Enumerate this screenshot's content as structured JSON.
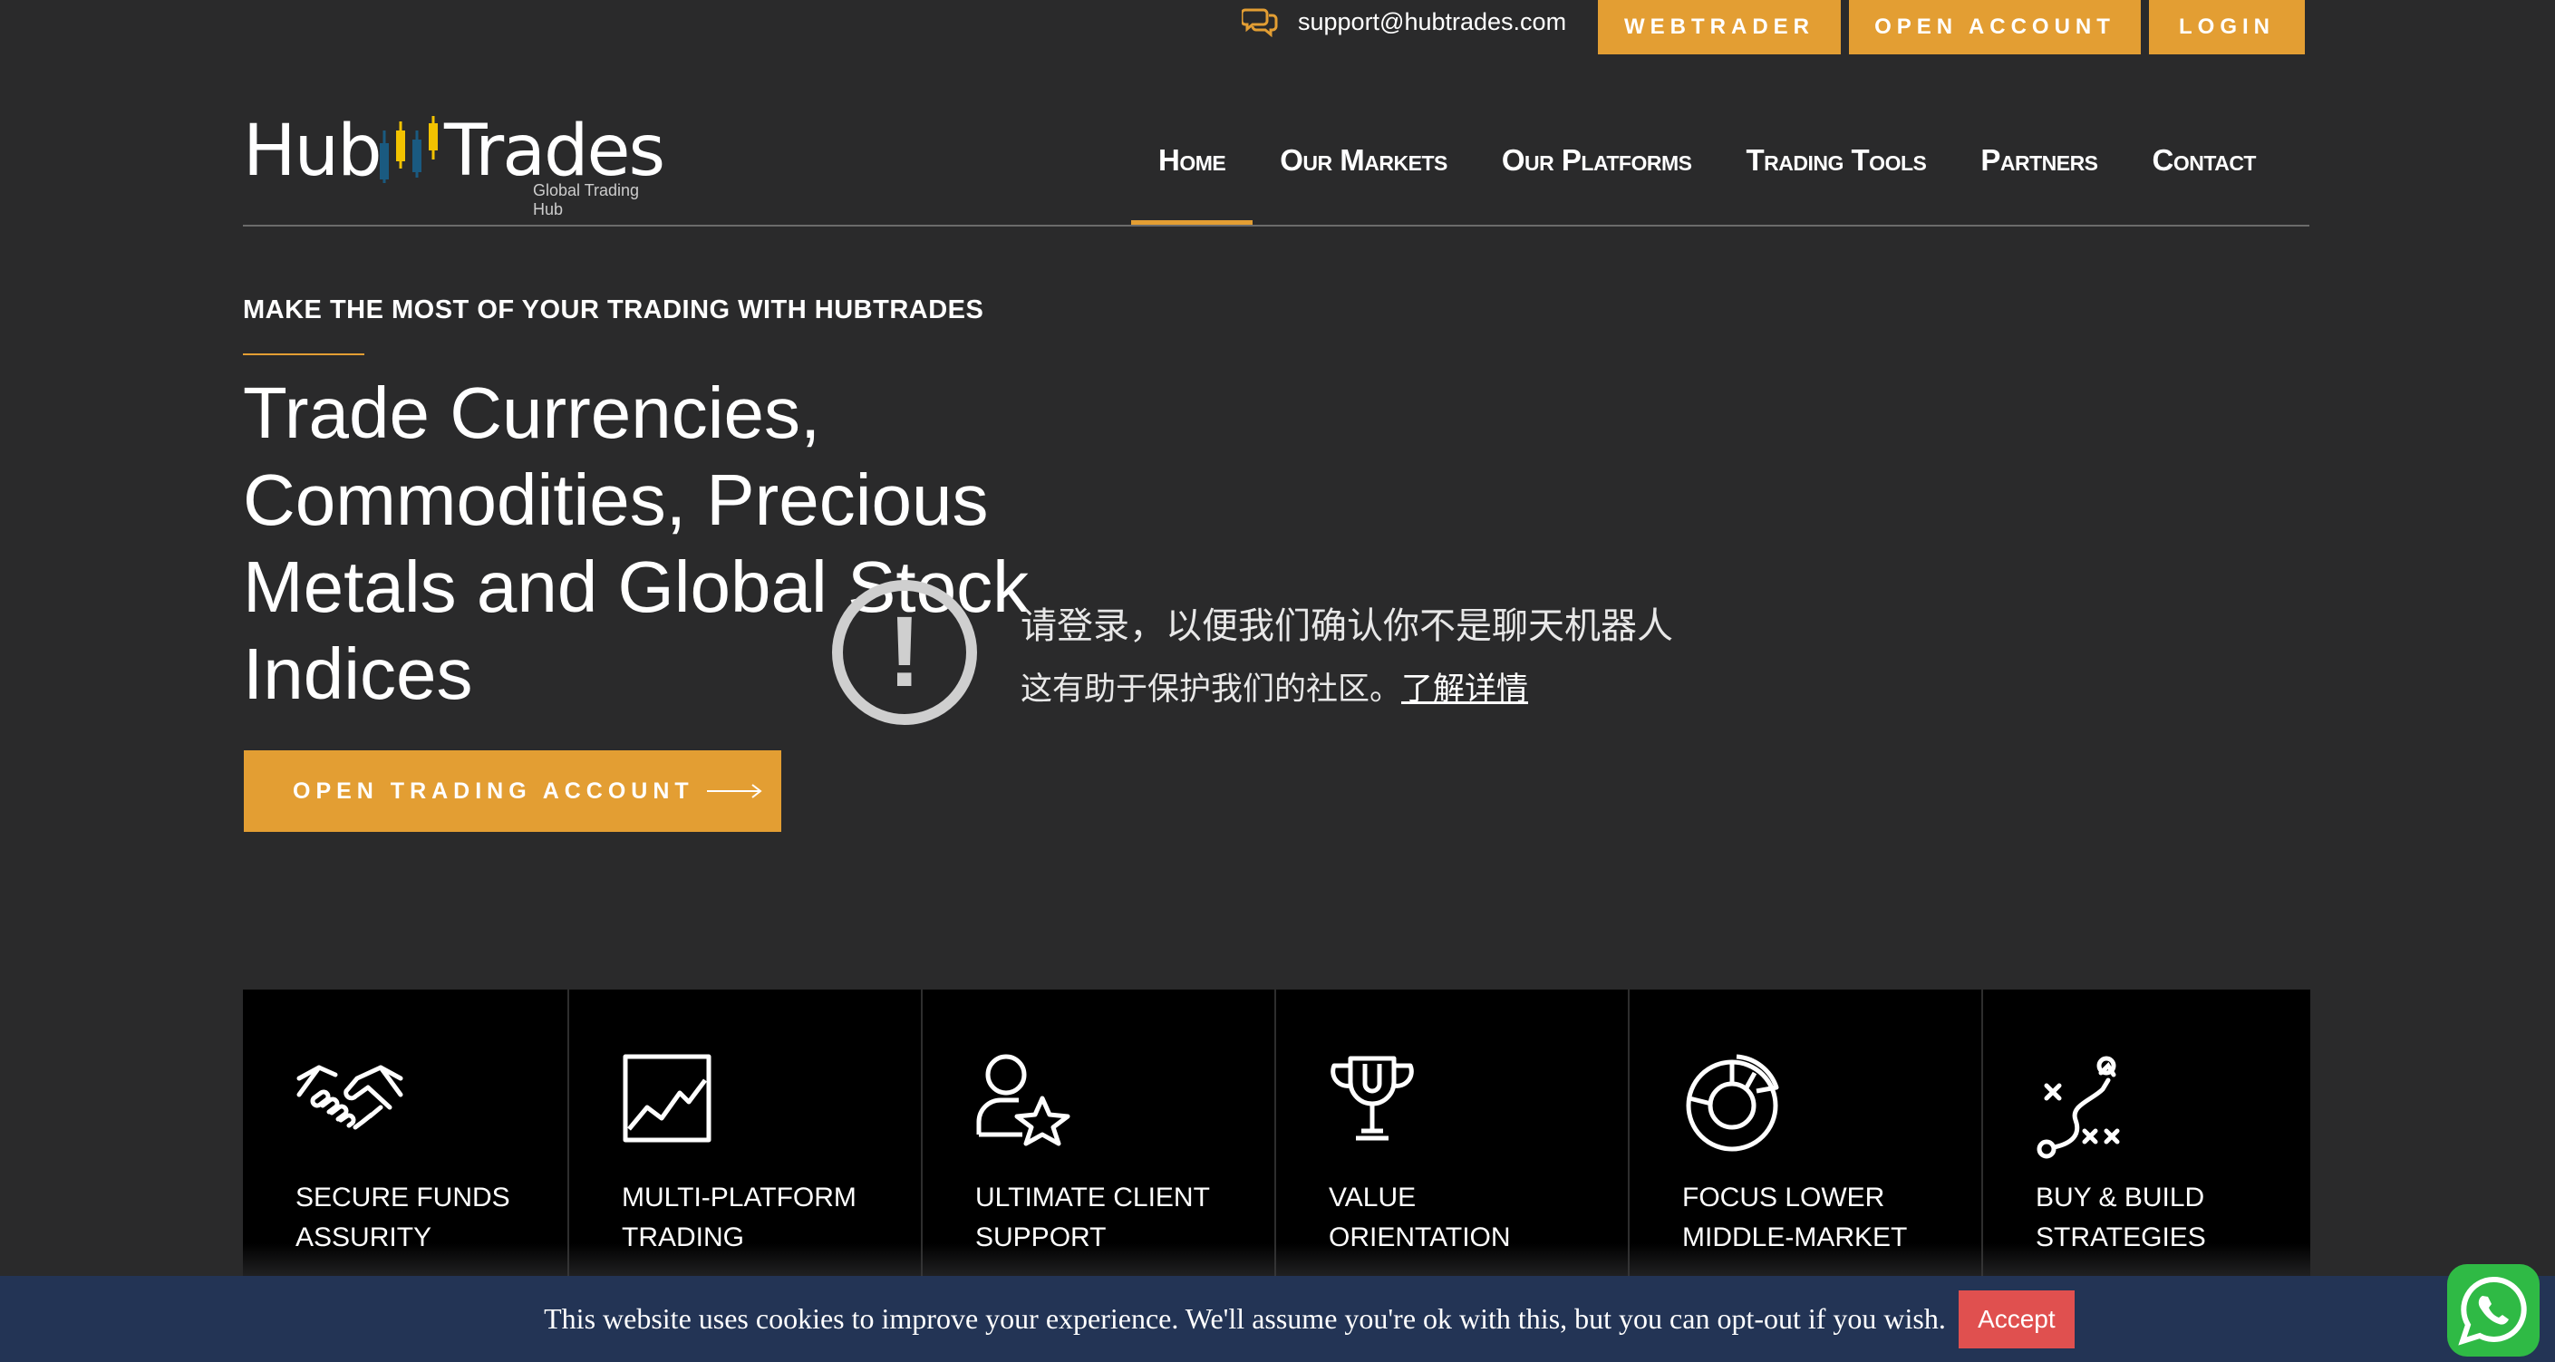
{
  "topbar": {
    "support_email": "support@hubtrades.com",
    "buttons": [
      "WEBTRADER",
      "OPEN ACCOUNT",
      "LOGIN"
    ]
  },
  "logo": {
    "part1": "Hub",
    "part2": "Trades",
    "tagline": "Global Trading Hub"
  },
  "nav": {
    "items": [
      "Home",
      "Our Markets",
      "Our Platforms",
      "Trading Tools",
      "Partners",
      "Contact"
    ],
    "active": "Home"
  },
  "hero": {
    "kicker": "MAKE THE MOST OF YOUR TRADING WITH HUBTRADES",
    "headline": "Trade Currencies, Commodities, Precious Metals and Global Stock Indices",
    "cta": "OPEN TRADING ACCOUNT"
  },
  "notice": {
    "line1": "请登录，以便我们确认你不是聊天机器人",
    "line2": "这有助于保护我们的社区。",
    "link": "了解详情"
  },
  "features": [
    {
      "label": "SECURE FUNDS ASSURITY",
      "icon": "handshake-icon"
    },
    {
      "label": "MULTI-PLATFORM TRADING",
      "icon": "chart-icon"
    },
    {
      "label": "ULTIMATE CLIENT SUPPORT",
      "icon": "user-star-icon"
    },
    {
      "label": "VALUE ORIENTATION",
      "icon": "trophy-icon"
    },
    {
      "label": "FOCUS LOWER MIDDLE-MARKET",
      "icon": "pie-chart-icon"
    },
    {
      "label": "BUY & BUILD STRATEGIES",
      "icon": "strategy-icon"
    }
  ],
  "cookie": {
    "message": "This website uses cookies to improve your experience. We'll assume you're ok with this, but you can opt-out if you wish.",
    "accept": "Accept"
  },
  "colors": {
    "accent": "#e39e33",
    "background": "#2a2a2b",
    "cookie_bar": "#233455",
    "accept_button": "#e0504f",
    "whatsapp": "#2fba45"
  }
}
